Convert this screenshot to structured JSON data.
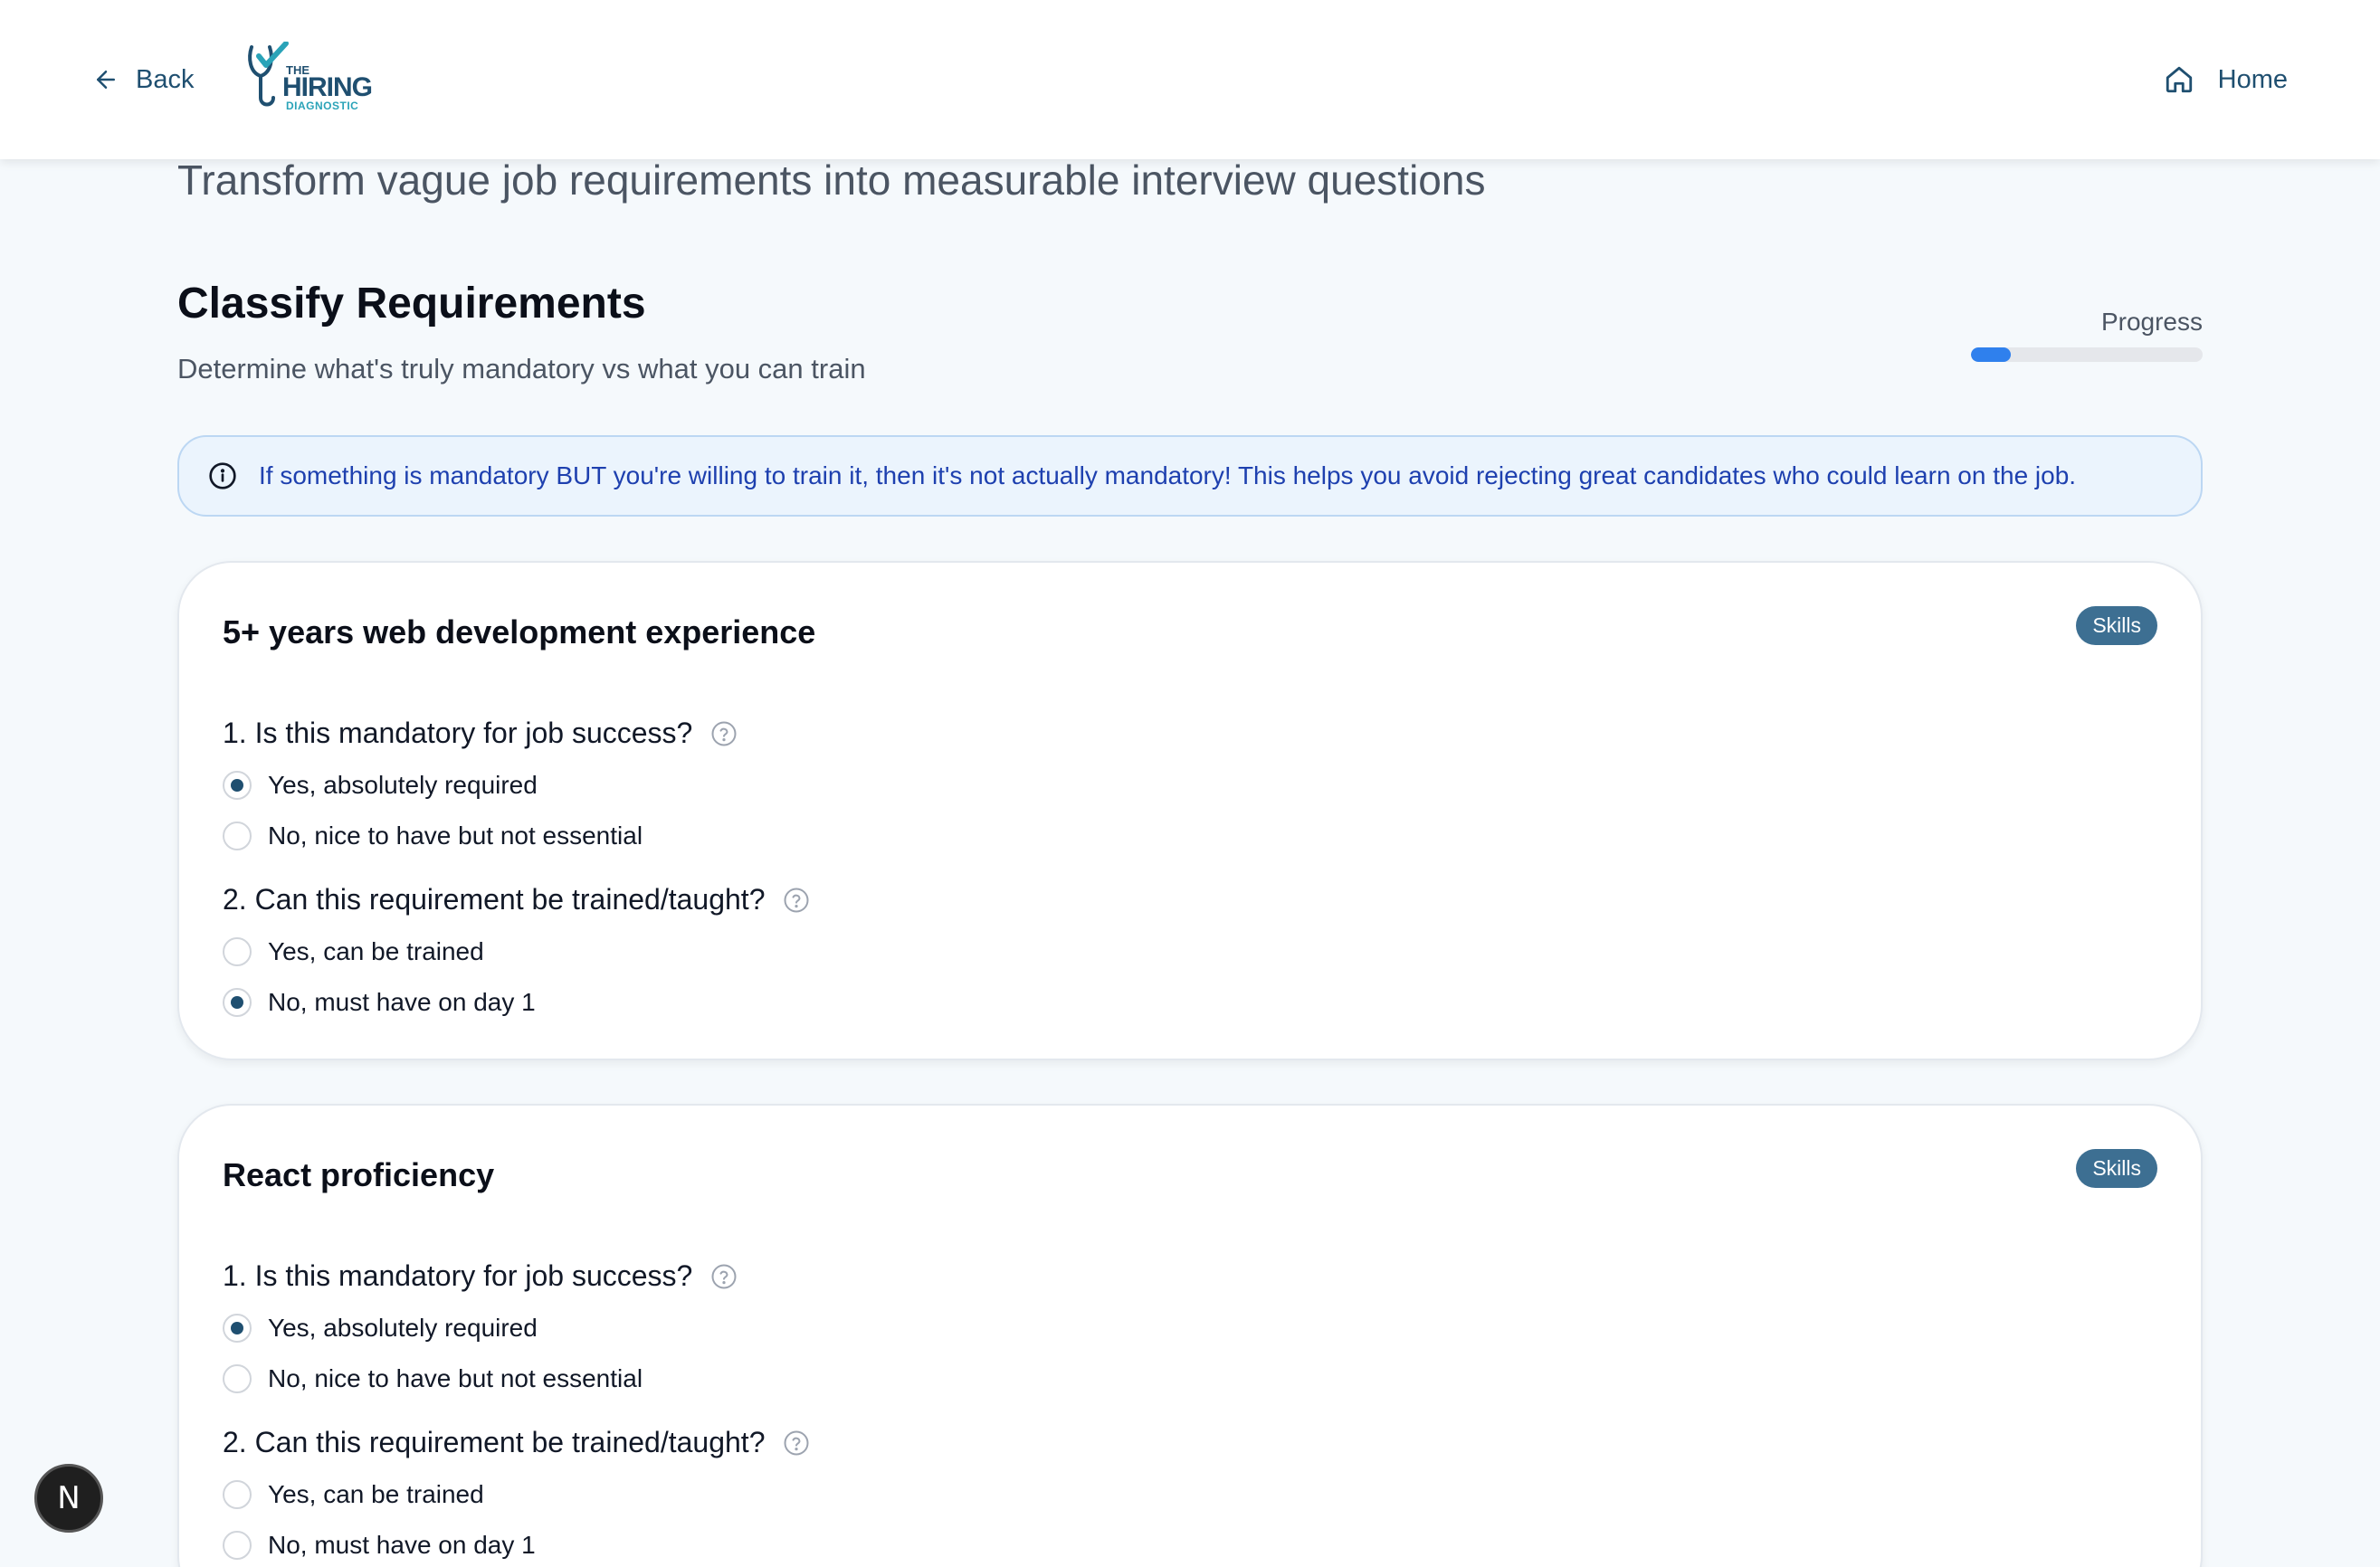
{
  "header": {
    "back_label": "Back",
    "logo": {
      "the": "THE",
      "hiring": "HIRING",
      "diagnostic": "DIAGNOSTIC"
    },
    "home_label": "Home"
  },
  "tagline": "Transform vague job requirements into measurable interview questions",
  "section": {
    "title": "Classify Requirements",
    "subtitle": "Determine what's truly mandatory vs what you can train",
    "progress_label": "Progress",
    "progress_fraction": 0.17
  },
  "info": {
    "text": "If something is mandatory BUT you're willing to train it, then it's not actually mandatory! This helps you avoid rejecting great candidates who could learn on the job."
  },
  "cards": [
    {
      "title": "5+ years web development experience",
      "badge": "Skills",
      "q1": {
        "label": "1. Is this mandatory for job success?",
        "options": [
          "Yes, absolutely required",
          "No, nice to have but not essential"
        ],
        "selected": 0
      },
      "q2": {
        "label": "2. Can this requirement be trained/taught?",
        "options": [
          "Yes, can be trained",
          "No, must have on day 1"
        ],
        "selected": 1
      }
    },
    {
      "title": "React proficiency",
      "badge": "Skills",
      "q1": {
        "label": "1. Is this mandatory for job success?",
        "options": [
          "Yes, absolutely required",
          "No, nice to have but not essential"
        ],
        "selected": 0
      },
      "q2": {
        "label": "2. Can this requirement be trained/taught?",
        "options": [
          "Yes, can be trained",
          "No, must have on day 1"
        ],
        "selected": -1
      }
    }
  ],
  "dev_badge": "N",
  "colors": {
    "accent": "#1f4f70",
    "progress": "#2f80ed",
    "badge": "#3d6f92",
    "info_bg": "#ebf4fd",
    "info_text": "#1e40af"
  }
}
